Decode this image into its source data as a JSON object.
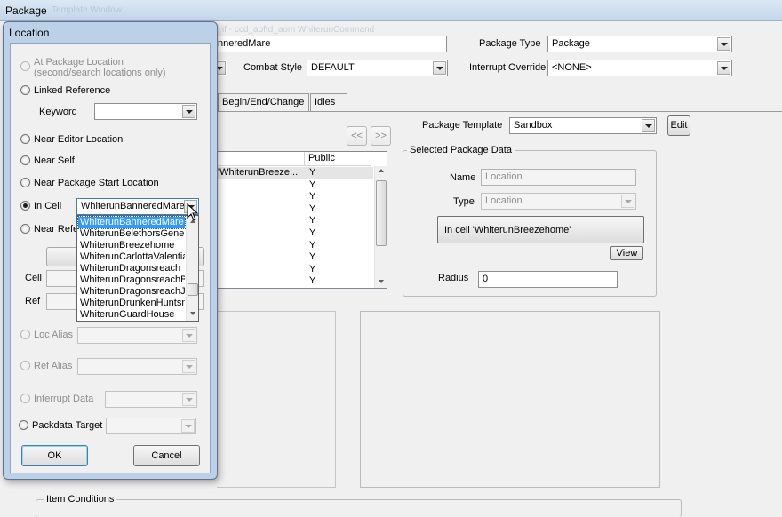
{
  "main": {
    "title": "Package",
    "title_ghost": "Template Window",
    "ghost_row": "if - ccd_aoftd_aom WhiterunCommand",
    "package_id_value": "nneredMare",
    "package_type_label": "Package Type",
    "package_type_value": "Package",
    "combat_style_label": "Combat Style",
    "combat_style_value": "DEFAULT",
    "interrupt_override_label": "Interrupt Override",
    "interrupt_override_value": "<NONE>",
    "tabs": [
      {
        "label": "Begin/End/Change"
      },
      {
        "label": "Idles"
      }
    ],
    "nav_prev": "<<",
    "nav_next": ">>",
    "package_template_label": "Package Template",
    "package_template_value": "Sandbox",
    "edit_button": "Edit",
    "list": {
      "public_header": "Public",
      "rows": [
        {
          "name": "'WhiterunBreeze...",
          "public": "Y"
        },
        {
          "name": "",
          "public": "Y"
        },
        {
          "name": "",
          "public": "Y"
        },
        {
          "name": "",
          "public": "Y"
        },
        {
          "name": "",
          "public": "Y"
        },
        {
          "name": "",
          "public": "Y"
        },
        {
          "name": "",
          "public": "Y"
        },
        {
          "name": "",
          "public": "Y"
        },
        {
          "name": "",
          "public": "Y"
        },
        {
          "name": "",
          "public": "Y"
        }
      ]
    },
    "selected_data": {
      "title": "Selected Package Data",
      "name_label": "Name",
      "name_value": "Location",
      "type_label": "Type",
      "type_value": "Location",
      "summary": "In cell 'WhiterunBreezehome'",
      "view_button": "View",
      "radius_label": "Radius",
      "radius_value": "0"
    },
    "item_conditions_label": "Item Conditions"
  },
  "dialog": {
    "title": "Location",
    "options": {
      "at_package_location": "At Package Location",
      "at_package_location_note": "(second/search locations only)",
      "linked_reference": "Linked Reference",
      "keyword_label": "Keyword",
      "keyword_value": "",
      "near_editor_location": "Near Editor Location",
      "near_self": "Near Self",
      "near_package_start_location": "Near Package Start Location",
      "in_cell": "In Cell",
      "in_cell_value": "WhiterunBanneredMare",
      "near_reference": "Near Refe",
      "cell_label": "Cell",
      "ref_label": "Ref",
      "loc_alias": "Loc Alias",
      "ref_alias": "Ref Alias",
      "interrupt_data": "Interrupt Data",
      "packdata_target": "Packdata Target"
    },
    "cell_list": [
      "WhiterunBanneredMare",
      "WhiterunBelethorsGeneralGoods",
      "WhiterunBreezehome",
      "WhiterunCarlottaValentia",
      "WhiterunDragonsreach",
      "WhiterunDragonsreachBasement",
      "WhiterunDragonsreachJarlsQuarters",
      "WhiterunDrunkenHuntsman",
      "WhiterunGuardHouse"
    ],
    "ok_button": "OK",
    "cancel_button": "Cancel"
  },
  "colors": {
    "highlight": "#3399ff",
    "dialog_frame": "#bcd1e8",
    "window_bg": "#f0f0f0"
  }
}
